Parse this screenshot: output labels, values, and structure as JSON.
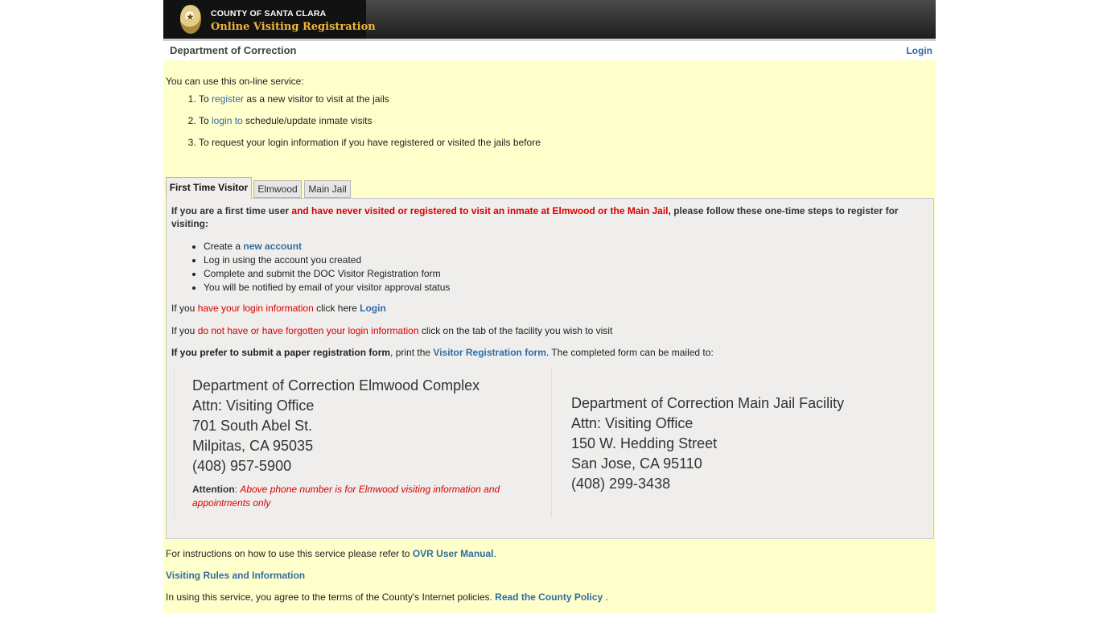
{
  "header": {
    "county": "COUNTY OF SANTA CLARA",
    "app_title": "Online Visiting Registration",
    "department": "Department of Correction",
    "login": "Login"
  },
  "intro": {
    "text": "You can use this on-line service:",
    "steps": [
      {
        "pre": "To ",
        "link": "register",
        "post": " as a new visitor to visit at the jails"
      },
      {
        "pre": "To ",
        "link": "login to",
        "post": " schedule/update inmate visits"
      },
      {
        "pre": "To request your login information if you have registered or visited the jails before",
        "link": "",
        "post": ""
      }
    ]
  },
  "tabs": [
    "First Time Visitor",
    "Elmwood",
    "Main Jail"
  ],
  "first_time": {
    "intro_a": "If you are a first time user ",
    "intro_red": "and have never visited or registered to visit an inmate at Elmwood or the Main Jail",
    "intro_b": ", please follow these one-time steps to register for visiting:",
    "bullets": [
      {
        "text": "Create a ",
        "link": "new account"
      },
      {
        "text": "Log in using the account you created",
        "link": ""
      },
      {
        "text": "Complete and submit the DOC Visitor Registration form",
        "link": ""
      },
      {
        "text": "You will be notified by email of your visitor approval status",
        "link": ""
      }
    ],
    "login_line": {
      "pre": "If you ",
      "red": "have your login information",
      "mid": " click here ",
      "link": "Login"
    },
    "forgot_line": {
      "pre": "If you ",
      "red": "do not have or have forgotten your login information",
      "post": " click on the tab of the facility you wish to visit"
    },
    "paper_line": {
      "bold": "If you prefer to submit a paper registration form",
      "pre": ", print the ",
      "link": "Visitor Registration form",
      "post": ". The completed form can be mailed to:"
    }
  },
  "addresses": {
    "elmwood": [
      "Department of Correction Elmwood Complex",
      "Attn: Visiting Office",
      "701 South Abel St.",
      "Milpitas, CA 95035",
      "(408) 957-5900"
    ],
    "attention_label": "Attention",
    "attention_colon": ": ",
    "attention_text": "Above phone number is for Elmwood visiting information and appointments only",
    "main_jail": [
      "Department of Correction Main Jail Facility",
      "Attn: Visiting Office",
      "150 W. Hedding Street",
      "San Jose, CA 95110",
      "(408) 299-3438"
    ]
  },
  "footer": {
    "manual_pre": "For instructions on how to use this service please refer to ",
    "manual_link": "OVR User Manual",
    "manual_post": ".",
    "rules_link": "Visiting Rules and Information",
    "policy_pre": "In using this service, you agree to the terms of the County's Internet policies. ",
    "policy_link": "Read the County Policy",
    "policy_post": " ."
  },
  "colors": {
    "link": "#2e6da4",
    "alert": "#d80000",
    "background": "#ffffcc",
    "panel": "#efeeec",
    "brand_gold": "#f0b63a"
  }
}
